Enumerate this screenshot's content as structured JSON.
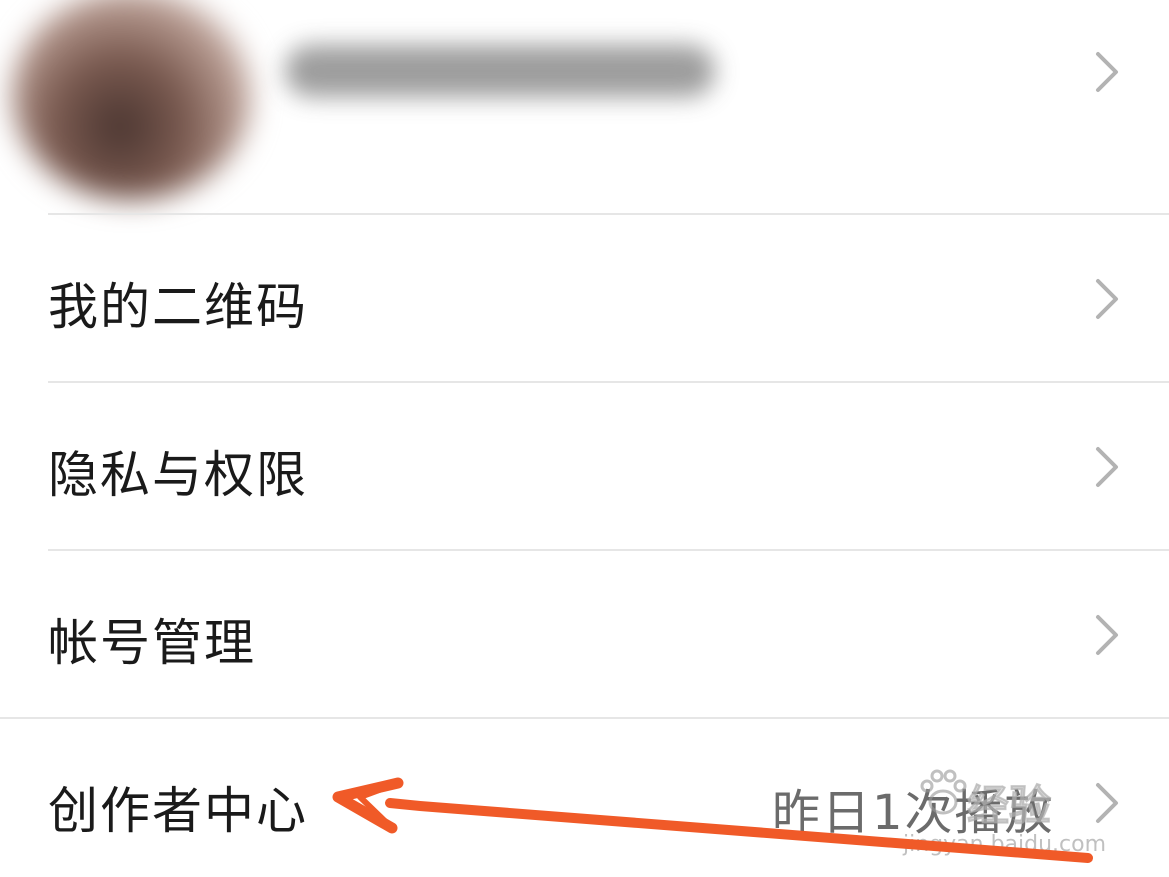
{
  "profile": {
    "avatar_icon": "avatar-blurred",
    "name_blurred": true
  },
  "menu": {
    "items": [
      {
        "label": "我的二维码"
      },
      {
        "label": "隐私与权限"
      },
      {
        "label": "帐号管理"
      },
      {
        "label": "创作者中心",
        "value": "昨日1次播放"
      }
    ]
  },
  "watermark": {
    "brand": "经验",
    "url": "jingyan.baidu.com"
  },
  "annotation": {
    "arrow_color": "#f05a28"
  },
  "colors": {
    "chevron": "#b3b3b3",
    "text": "#1a1a1a",
    "value_text": "#6b6b6b",
    "divider": "#e6e6e6"
  }
}
